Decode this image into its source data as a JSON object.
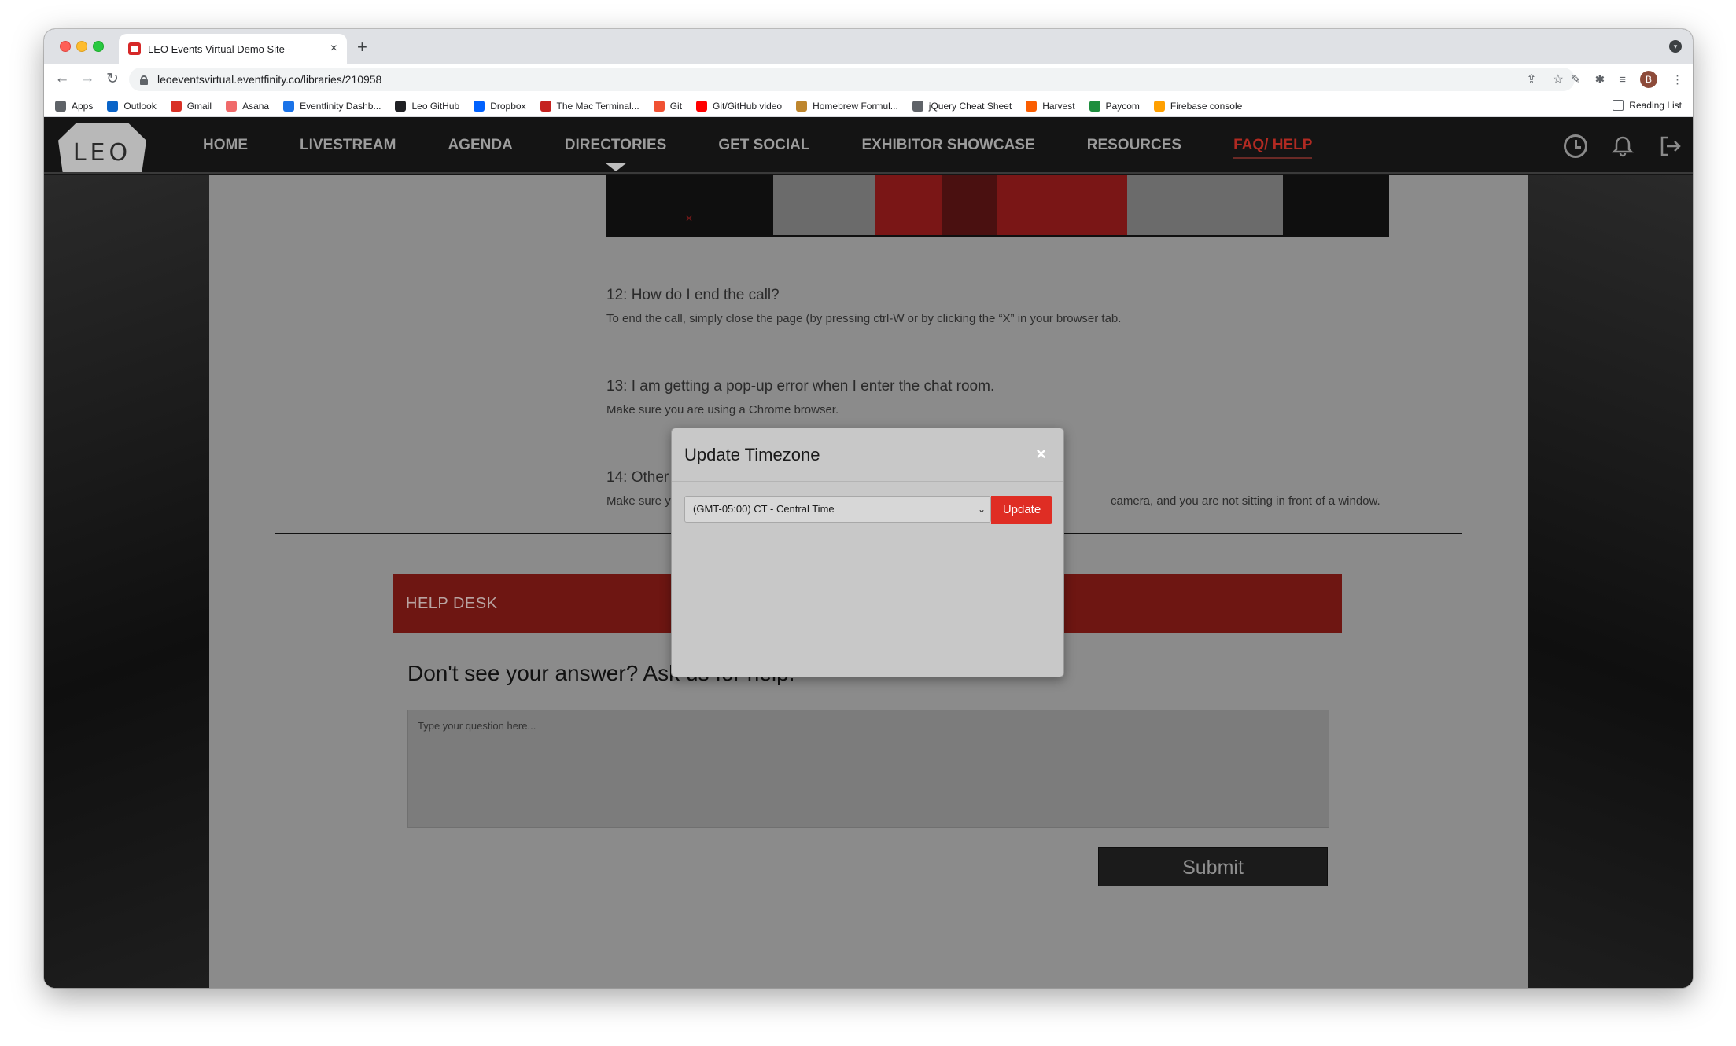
{
  "browser": {
    "tab_title": "LEO Events Virtual Demo Site -",
    "tab_close": "×",
    "new_tab": "+",
    "url": "leoeventsvirtual.eventfinity.co/libraries/210958",
    "profile_initial": "B",
    "bookmarks": [
      {
        "label": "Apps",
        "color": "#5f6368"
      },
      {
        "label": "Outlook",
        "color": "#0a64c8"
      },
      {
        "label": "Gmail",
        "color": "#d93025"
      },
      {
        "label": "Asana",
        "color": "#f06a6a"
      },
      {
        "label": "Eventfinity Dashb...",
        "color": "#1a73e8"
      },
      {
        "label": "Leo GitHub",
        "color": "#202124"
      },
      {
        "label": "Dropbox",
        "color": "#0061fe"
      },
      {
        "label": "The Mac Terminal...",
        "color": "#c5221f"
      },
      {
        "label": "Git",
        "color": "#f05133"
      },
      {
        "label": "Git/GitHub video",
        "color": "#ff0000"
      },
      {
        "label": "Homebrew Formul...",
        "color": "#be862d"
      },
      {
        "label": "jQuery Cheat Sheet",
        "color": "#5f6368"
      },
      {
        "label": "Harvest",
        "color": "#fa5d00"
      },
      {
        "label": "Paycom",
        "color": "#1e8e3e"
      },
      {
        "label": "Firebase console",
        "color": "#ffa000"
      }
    ],
    "reading_list": "Reading List"
  },
  "site": {
    "logo": "LEO",
    "menu": [
      "HOME",
      "LIVESTREAM",
      "AGENDA",
      "DIRECTORIES",
      "GET SOCIAL",
      "EXHIBITOR SHOWCASE",
      "RESOURCES",
      "FAQ/ HELP"
    ],
    "active_menu": "FAQ/ HELP",
    "faq": [
      {
        "q": "12: How do I end the call?",
        "a": "To end the call, simply close the page (by pressing ctrl-W or by clicking the “X” in your browser tab."
      },
      {
        "q": "13: I am getting a pop-up error when I enter the chat room.",
        "a": "Make sure you are using a Chrome browser."
      },
      {
        "q": "14: Other",
        "a": "Make sure y"
      }
    ],
    "faq14_tail": "camera, and you are not sitting in front of a window.",
    "helpdesk": "HELP DESK",
    "ask_heading": "Don't see your answer? Ask us for help.",
    "question_placeholder": "Type your question here...",
    "submit": "Submit"
  },
  "modal": {
    "title": "Update Timezone",
    "close": "×",
    "selected_timezone": "(GMT-05:00) CT - Central Time",
    "update": "Update"
  },
  "colors": {
    "accent_red": "#df2d24",
    "active_nav": "#b02a22",
    "helpdesk_bar": "#6e1612"
  }
}
